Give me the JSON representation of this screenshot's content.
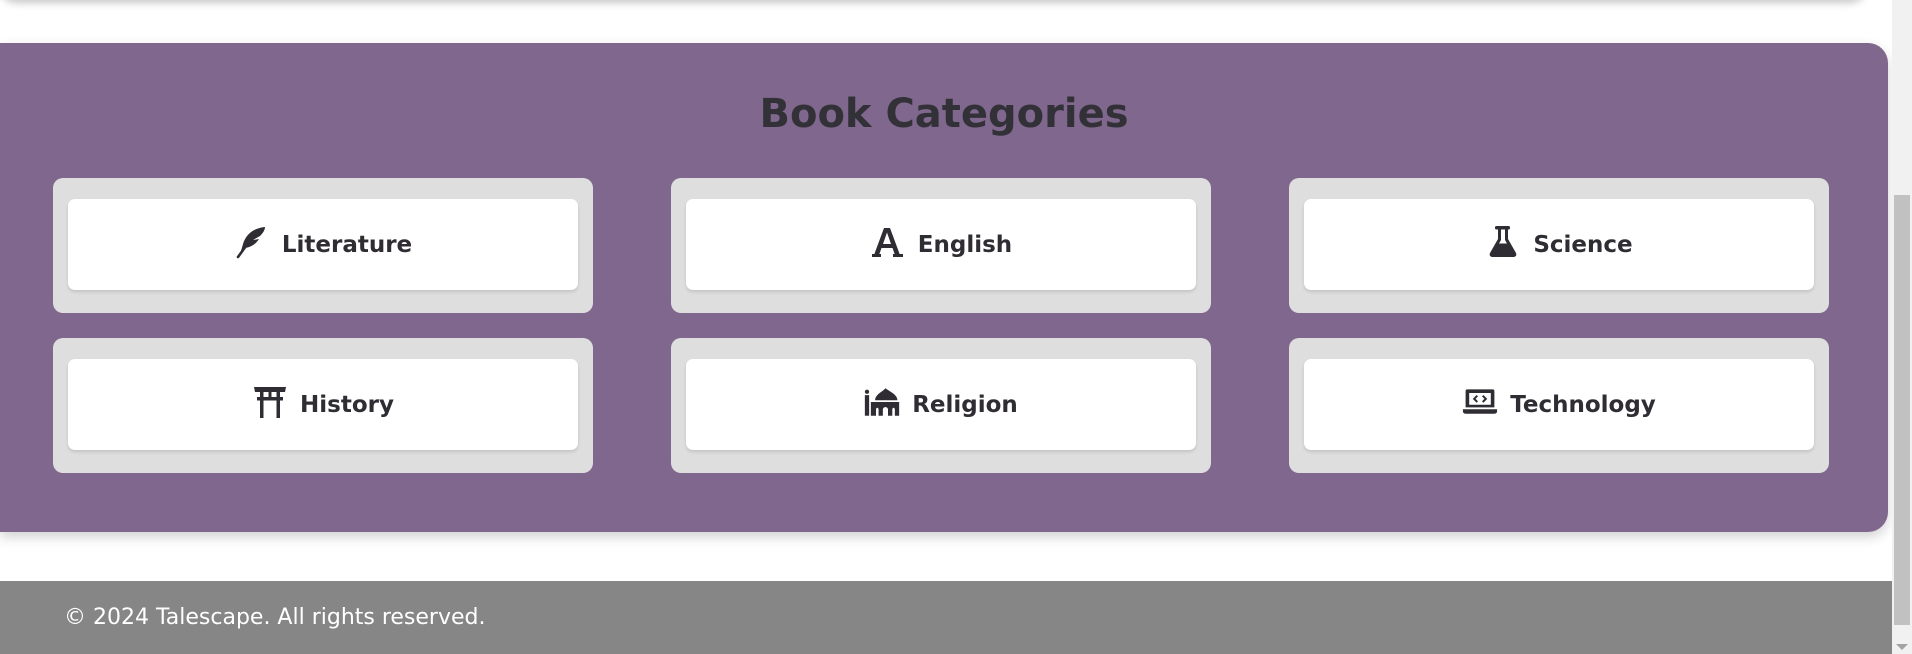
{
  "categories_section": {
    "title": "Book Categories",
    "background_color": "#80678e",
    "items": [
      {
        "label": "Literature",
        "icon": "feather-icon"
      },
      {
        "label": "English",
        "icon": "letter-a-icon"
      },
      {
        "label": "Science",
        "icon": "flask-icon"
      },
      {
        "label": "History",
        "icon": "torii-gate-icon"
      },
      {
        "label": "Religion",
        "icon": "mosque-icon"
      },
      {
        "label": "Technology",
        "icon": "laptop-code-icon"
      }
    ]
  },
  "footer": {
    "text": "© 2024 Talescape. All rights reserved.",
    "background_color": "#868686"
  }
}
